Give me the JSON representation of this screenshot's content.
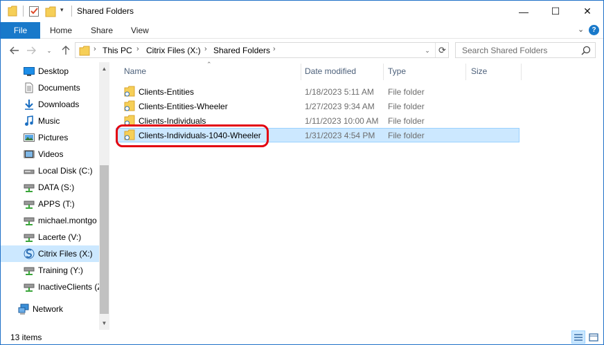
{
  "window": {
    "title": "Shared Folders",
    "controls": {
      "minimize": "—",
      "maximize": "☐",
      "close": "✕"
    }
  },
  "ribbon": {
    "tabs": [
      "File",
      "Home",
      "Share",
      "View"
    ],
    "help": "?"
  },
  "address": {
    "crumbs": [
      "This PC",
      "Citrix Files (X:)",
      "Shared Folders"
    ]
  },
  "search": {
    "placeholder": "Search Shared Folders"
  },
  "sidebar": {
    "items": [
      {
        "label": "Desktop",
        "icon": "desktop-icon"
      },
      {
        "label": "Documents",
        "icon": "documents-icon"
      },
      {
        "label": "Downloads",
        "icon": "downloads-icon"
      },
      {
        "label": "Music",
        "icon": "music-icon"
      },
      {
        "label": "Pictures",
        "icon": "pictures-icon"
      },
      {
        "label": "Videos",
        "icon": "videos-icon"
      },
      {
        "label": "Local Disk (C:)",
        "icon": "local-disk-icon"
      },
      {
        "label": "DATA (S:)",
        "icon": "network-drive-icon"
      },
      {
        "label": "APPS (T:)",
        "icon": "network-drive-icon"
      },
      {
        "label": "michael.montgo",
        "icon": "network-drive-icon"
      },
      {
        "label": "Lacerte (V:)",
        "icon": "network-drive-icon"
      },
      {
        "label": "Citrix Files (X:)",
        "icon": "citrix-files-icon",
        "selected": true
      },
      {
        "label": "Training (Y:)",
        "icon": "network-drive-icon"
      },
      {
        "label": "InactiveClients (Z",
        "icon": "network-drive-icon"
      },
      {
        "label": "Network",
        "icon": "network-icon"
      }
    ]
  },
  "columns": [
    "Name",
    "Date modified",
    "Type",
    "Size"
  ],
  "files": [
    {
      "name": "Clients-Entities",
      "date": "1/18/2023 5:11 AM",
      "type": "File folder",
      "size": ""
    },
    {
      "name": "Clients-Entities-Wheeler",
      "date": "1/27/2023 9:34 AM",
      "type": "File folder",
      "size": ""
    },
    {
      "name": "Clients-Individuals",
      "date": "1/11/2023 10:00 AM",
      "type": "File folder",
      "size": ""
    },
    {
      "name": "Clients-Individuals-1040-Wheeler",
      "date": "1/31/2023 4:54 PM",
      "type": "File folder",
      "size": "",
      "selected": true,
      "highlighted": true
    }
  ],
  "status": {
    "count": "13 items"
  },
  "colors": {
    "accent": "#1979ca",
    "selection": "#cce8ff",
    "highlight_ring": "#e3000f"
  }
}
